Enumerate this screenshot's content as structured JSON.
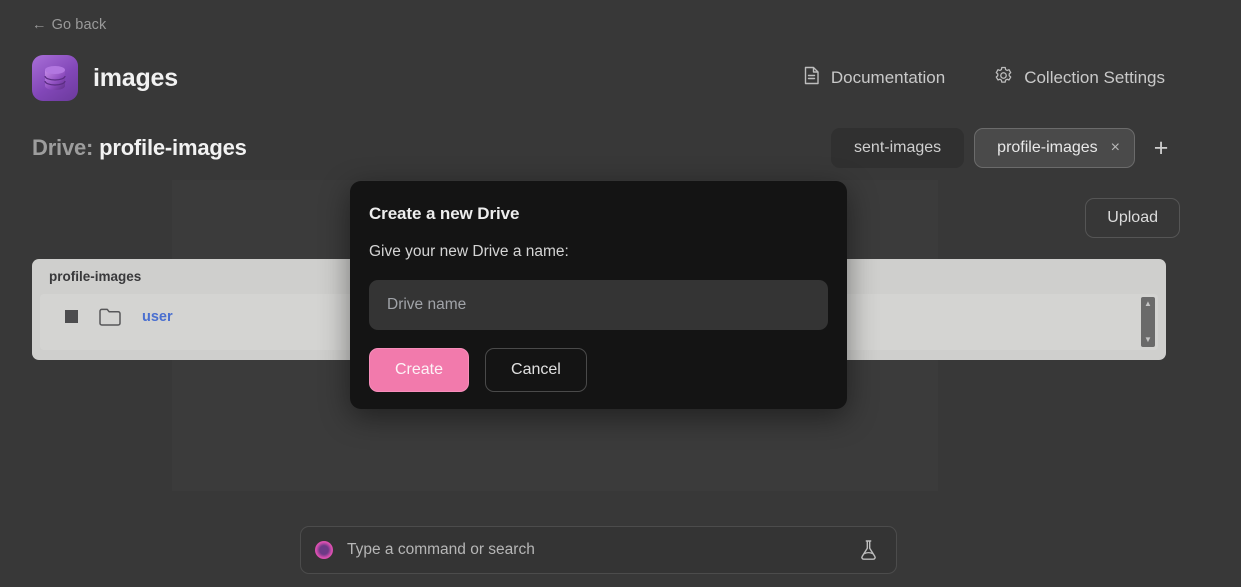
{
  "nav": {
    "go_back": "Go back",
    "go_back_arrow": "←"
  },
  "header": {
    "brand_title": "images",
    "logo_icon": "database-stack-icon",
    "links": [
      {
        "label": "Documentation",
        "icon": "document-icon"
      },
      {
        "label": "Collection Settings",
        "icon": "gear-icon"
      }
    ]
  },
  "drive": {
    "label": "Drive:",
    "name": "profile-images",
    "tabs": [
      {
        "label": "sent-images",
        "active": false
      },
      {
        "label": "profile-images",
        "active": true,
        "close": "×"
      }
    ],
    "add_tab": "+"
  },
  "toolbar": {
    "upload_label": "Upload"
  },
  "file_browser": {
    "header": "profile-images",
    "rows": [
      {
        "name": "user",
        "icon": "folder-icon",
        "checkbox": "checkbox-icon"
      }
    ],
    "scroll_up": "▲",
    "scroll_down": "▼"
  },
  "modal": {
    "title": "Create a new Drive",
    "subtitle": "Give your new Drive a name:",
    "input_value": "",
    "input_placeholder": "Drive name",
    "create_label": "Create",
    "cancel_label": "Cancel",
    "accent_color": "#f27aac"
  },
  "command_bar": {
    "value": "",
    "placeholder": "Type a command or search",
    "dot_icon": "status-dot-icon",
    "flask_icon": "flask-icon"
  }
}
